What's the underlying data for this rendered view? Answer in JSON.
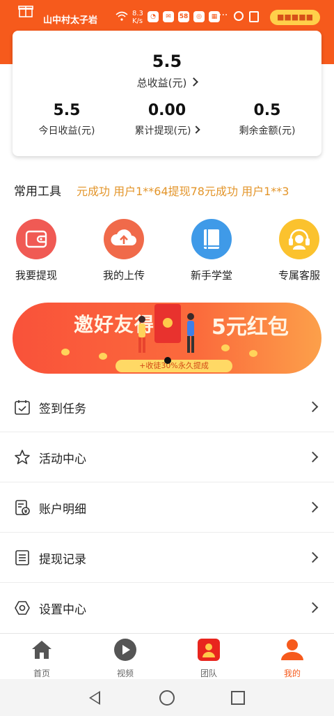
{
  "status_bar": {
    "carrier": "山中村太子岩",
    "net_speed_top": "8.3",
    "net_speed_bottom": "K/s",
    "app_badges": [
      "◔",
      "✉",
      "58",
      "◎",
      "▦"
    ],
    "pill_text": "■■■■■"
  },
  "earnings": {
    "total_value": "5.5",
    "total_label": "总收益(元)",
    "stats": [
      {
        "value": "5.5",
        "label": "今日收益(元)",
        "has_arrow": false
      },
      {
        "value": "0.00",
        "label": "累计提现(元)",
        "has_arrow": true
      },
      {
        "value": "0.5",
        "label": "剩余金额(元)",
        "has_arrow": false
      }
    ]
  },
  "tools": {
    "title": "常用工具",
    "marquee": "元成功 用户1**64提现78元成功 用户1**3",
    "items": [
      {
        "label": "我要提现",
        "icon": "wallet-icon",
        "color": "#f05a54"
      },
      {
        "label": "我的上传",
        "icon": "cloud-upload-icon",
        "color": "#f06a4a"
      },
      {
        "label": "新手学堂",
        "icon": "book-icon",
        "color": "#3f9ae8"
      },
      {
        "label": "专属客服",
        "icon": "headset-icon",
        "color": "#fbc22e"
      }
    ]
  },
  "banner": {
    "title_left": "邀好友得",
    "title_right": "5元红包",
    "strip_text": "+收徒30%永久提成"
  },
  "menu": [
    {
      "label": "签到任务",
      "icon": "calendar-check-icon"
    },
    {
      "label": "活动中心",
      "icon": "star-icon"
    },
    {
      "label": "账户明细",
      "icon": "bill-icon"
    },
    {
      "label": "提现记录",
      "icon": "document-icon"
    },
    {
      "label": "设置中心",
      "icon": "hexagon-settings-icon"
    }
  ],
  "tabs": [
    {
      "label": "首页",
      "icon": "home-icon",
      "active": false
    },
    {
      "label": "视频",
      "icon": "play-icon",
      "active": false
    },
    {
      "label": "团队",
      "icon": "team-icon",
      "active": false
    },
    {
      "label": "我的",
      "icon": "profile-icon",
      "active": true
    }
  ],
  "colors": {
    "brand_orange": "#f65a1c",
    "marquee_text": "#e3952a"
  }
}
